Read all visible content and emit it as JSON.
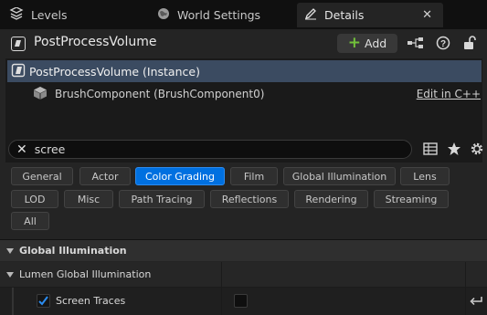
{
  "tabs": [
    {
      "label": "Levels",
      "icon": "levels-icon"
    },
    {
      "label": "World Settings",
      "icon": "globe-icon"
    },
    {
      "label": "Details",
      "icon": "pencil-icon",
      "active": true
    }
  ],
  "actor": {
    "title": "PostProcessVolume",
    "add_label": "Add"
  },
  "components": [
    {
      "label": "PostProcessVolume (Instance)",
      "selected": true
    },
    {
      "label": "BrushComponent (BrushComponent0)",
      "link": "Edit in C++"
    }
  ],
  "search": {
    "value": "scree"
  },
  "filters": [
    {
      "label": "General"
    },
    {
      "label": "Actor"
    },
    {
      "label": "Color Grading",
      "active": true
    },
    {
      "label": "Film"
    },
    {
      "label": "Global Illumination"
    },
    {
      "label": "Lens"
    },
    {
      "label": "LOD"
    },
    {
      "label": "Misc"
    },
    {
      "label": "Path Tracing"
    },
    {
      "label": "Reflections"
    },
    {
      "label": "Rendering"
    },
    {
      "label": "Streaming"
    },
    {
      "label": "All"
    }
  ],
  "sections": {
    "main": "Global Illumination",
    "sub": "Lumen Global Illumination",
    "property": {
      "label": "Screen Traces",
      "override_checked": true,
      "value_checked": false
    }
  },
  "colors": {
    "accent": "#0070e0",
    "selection": "#3b4b61",
    "add_plus": "#72c13a"
  }
}
